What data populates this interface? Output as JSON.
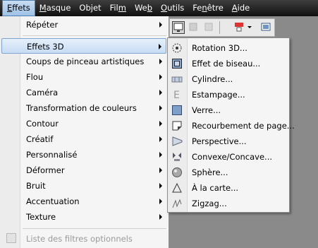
{
  "menubar": {
    "items": [
      {
        "u": "E",
        "rest": "ffets"
      },
      {
        "u": "M",
        "rest": "asque"
      },
      {
        "pre": "Ob",
        "u": "j",
        "rest": "et"
      },
      {
        "pre": "Fil",
        "u": "m",
        "rest": ""
      },
      {
        "pre": "We",
        "u": "b",
        "rest": ""
      },
      {
        "u": "O",
        "rest": "utils"
      },
      {
        "pre": "Fe",
        "u": "n",
        "rest": "être"
      },
      {
        "u": "A",
        "rest": "ide"
      }
    ]
  },
  "effects_menu": {
    "items": [
      {
        "label": "Répéter"
      },
      {
        "label": "Effets 3D"
      },
      {
        "label": "Coups de pinceau artistiques"
      },
      {
        "label": "Flou"
      },
      {
        "label": "Caméra"
      },
      {
        "label": "Transformation de couleurs"
      },
      {
        "label": "Contour"
      },
      {
        "label": "Créatif"
      },
      {
        "label": "Personnalisé"
      },
      {
        "label": "Déformer"
      },
      {
        "label": "Bruit"
      },
      {
        "label": "Accentuation"
      },
      {
        "label": "Texture"
      }
    ],
    "footer_item": {
      "label": "Liste des filtres optionnels"
    }
  },
  "effets3d_menu": {
    "items": [
      {
        "label": "Rotation 3D...",
        "icon": "rotation-3d-icon"
      },
      {
        "label": "Effet de biseau...",
        "icon": "bevel-icon"
      },
      {
        "label": "Cylindre...",
        "icon": "cylinder-icon"
      },
      {
        "label": "Estampage...",
        "icon": "emboss-icon"
      },
      {
        "label": "Verre...",
        "icon": "glass-icon"
      },
      {
        "label": "Recourbement de page...",
        "icon": "page-curl-icon"
      },
      {
        "label": "Perspective...",
        "icon": "perspective-icon"
      },
      {
        "label": "Convexe/Concave...",
        "icon": "pinch-punch-icon"
      },
      {
        "label": "Sphère...",
        "icon": "sphere-icon"
      },
      {
        "label": "À la carte...",
        "icon": "the-boss-icon"
      },
      {
        "label": "Zigzag...",
        "icon": "zigzag-icon"
      }
    ]
  },
  "colors": {
    "menubar_bg": "#1a1a1a",
    "highlight": "#c7dcf3",
    "menu_bg": "#f5f5f5"
  }
}
